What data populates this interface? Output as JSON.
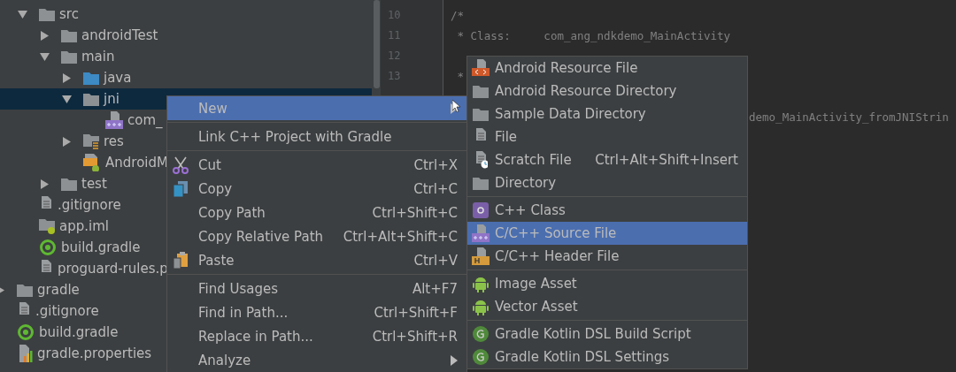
{
  "project_tree": {
    "items": [
      {
        "label": "src",
        "kind": "folder",
        "expanded": true,
        "selected": false,
        "children": [
          {
            "label": "androidTest",
            "kind": "folder",
            "expanded": false,
            "selected": false
          },
          {
            "label": "main",
            "kind": "folder",
            "expanded": true,
            "selected": false,
            "children": [
              {
                "label": "java",
                "kind": "source-folder",
                "expanded": false,
                "selected": false
              },
              {
                "label": "jni",
                "kind": "folder",
                "expanded": true,
                "selected": true,
                "children": [
                  {
                    "label": "com_",
                    "kind": "cpp-file",
                    "selected": false
                  }
                ]
              },
              {
                "label": "res",
                "kind": "res-folder",
                "expanded": false,
                "selected": false
              },
              {
                "label": "AndroidM",
                "kind": "manifest",
                "selected": false
              }
            ]
          },
          {
            "label": "test",
            "kind": "folder",
            "expanded": false,
            "selected": false
          }
        ]
      },
      {
        "label": ".gitignore",
        "kind": "text-file",
        "selected": false
      },
      {
        "label": "app.iml",
        "kind": "module-file",
        "selected": false
      },
      {
        "label": "build.gradle",
        "kind": "gradle",
        "selected": false
      },
      {
        "label": "proguard-rules.p",
        "kind": "text-file",
        "selected": false
      }
    ],
    "outer_items": [
      {
        "label": "gradle",
        "kind": "folder",
        "expanded": false,
        "selected": false
      },
      {
        "label": ".gitignore",
        "kind": "text-file",
        "selected": false
      },
      {
        "label": "build.gradle",
        "kind": "gradle",
        "selected": false
      },
      {
        "label": "gradle.properties",
        "kind": "properties",
        "selected": false
      }
    ]
  },
  "editor": {
    "lines": [
      {
        "number": "10",
        "text": "/*",
        "kind": "full"
      },
      {
        "number": "11",
        "text": " * Class:     com_ang_ndkdemo_MainActivity",
        "kind": "full"
      },
      {
        "number": "12",
        "kind": "hidden"
      },
      {
        "number": "13",
        "text": " *",
        "kind": "full"
      },
      {
        "kind": "hidden"
      },
      {
        "text": "demo_MainActivity_fromJNIStrin",
        "kind": "tail"
      }
    ]
  },
  "context_menu": {
    "groups": [
      [
        {
          "label": "New",
          "kind": "none",
          "submenu": true,
          "selected": true
        }
      ],
      [
        {
          "label": "Link C++ Project with Gradle",
          "kind": "none",
          "selected": false
        }
      ],
      [
        {
          "label": "Cut",
          "kind": "cut",
          "shortcut": "Ctrl+X",
          "selected": false
        },
        {
          "label": "Copy",
          "kind": "copy",
          "shortcut": "Ctrl+C",
          "selected": false
        },
        {
          "label": "Copy Path",
          "kind": "none",
          "shortcut": "Ctrl+Shift+C",
          "selected": false
        },
        {
          "label": "Copy Relative Path",
          "kind": "none",
          "shortcut": "Ctrl+Alt+Shift+C",
          "selected": false
        },
        {
          "label": "Paste",
          "kind": "paste",
          "shortcut": "Ctrl+V",
          "selected": false
        }
      ],
      [
        {
          "label": "Find Usages",
          "kind": "none",
          "shortcut": "Alt+F7",
          "selected": false
        },
        {
          "label": "Find in Path...",
          "kind": "none",
          "shortcut": "Ctrl+Shift+F",
          "selected": false
        },
        {
          "label": "Replace in Path...",
          "kind": "none",
          "shortcut": "Ctrl+Shift+R",
          "selected": false
        },
        {
          "label": "Analyze",
          "kind": "none",
          "submenu": true,
          "selected": false
        }
      ]
    ]
  },
  "new_submenu": {
    "groups": [
      [
        {
          "label": "Android Resource File",
          "kind": "res-file",
          "selected": false
        },
        {
          "label": "Android Resource Directory",
          "kind": "folder",
          "selected": false
        },
        {
          "label": "Sample Data Directory",
          "kind": "folder",
          "selected": false
        },
        {
          "label": "File",
          "kind": "text-file",
          "selected": false
        },
        {
          "label": "Scratch File",
          "kind": "scratch",
          "shortcut": "Ctrl+Alt+Shift+Insert",
          "selected": false
        },
        {
          "label": "Directory",
          "kind": "folder",
          "selected": false
        }
      ],
      [
        {
          "label": "C++ Class",
          "kind": "cpp-class",
          "selected": false
        },
        {
          "label": "C/C++ Source File",
          "kind": "cpp-file",
          "selected": true
        },
        {
          "label": "C/C++ Header File",
          "kind": "header-file",
          "selected": false
        }
      ],
      [
        {
          "label": "Image Asset",
          "kind": "android",
          "selected": false
        },
        {
          "label": "Vector Asset",
          "kind": "android",
          "selected": false
        }
      ],
      [
        {
          "label": "Gradle Kotlin DSL Build Script",
          "kind": "gradle-kts",
          "selected": false
        },
        {
          "label": "Gradle Kotlin DSL Settings",
          "kind": "gradle-kts",
          "selected": false
        }
      ]
    ]
  }
}
